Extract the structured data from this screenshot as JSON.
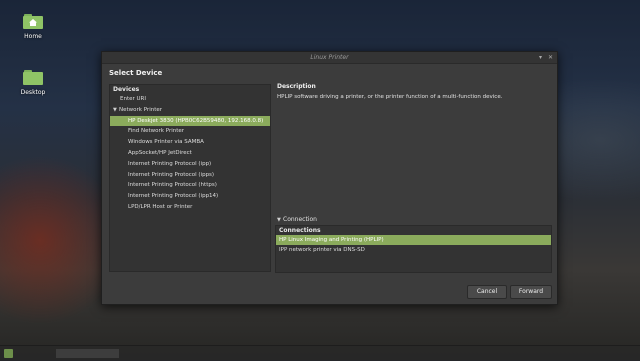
{
  "desktop": {
    "icons": [
      {
        "label": "Home"
      },
      {
        "label": "Desktop"
      }
    ]
  },
  "window": {
    "title": "Linux Printer",
    "header": "Select Device",
    "devices": {
      "heading": "Devices",
      "items": [
        {
          "label": "Enter URI"
        },
        {
          "label": "Network Printer"
        },
        {
          "label": "HP Deskjet 3830 (HPB0C62B59480, 192.168.0.8)"
        },
        {
          "label": "Find Network Printer"
        },
        {
          "label": "Windows Printer via SAMBA"
        },
        {
          "label": "AppSocket/HP JetDirect"
        },
        {
          "label": "Internet Printing Protocol (ipp)"
        },
        {
          "label": "Internet Printing Protocol (ipps)"
        },
        {
          "label": "Internet Printing Protocol (https)"
        },
        {
          "label": "Internet Printing Protocol (ipp14)"
        },
        {
          "label": "LPD/LPR Host or Printer"
        }
      ]
    },
    "description": {
      "heading": "Description",
      "text": "HPLIP software driving a printer, or the printer function of a multi-function device."
    },
    "connection": {
      "toggle_label": "Connection",
      "heading": "Connections",
      "items": [
        {
          "label": "HP Linux Imaging and Printing (HPLIP)"
        },
        {
          "label": "IPP network printer via DNS-SD"
        }
      ]
    },
    "buttons": {
      "cancel": "Cancel",
      "forward": "Forward"
    }
  },
  "colors": {
    "selection": "#8bab5c",
    "window_bg": "#3c3c3c",
    "folder": "#8fc466"
  }
}
